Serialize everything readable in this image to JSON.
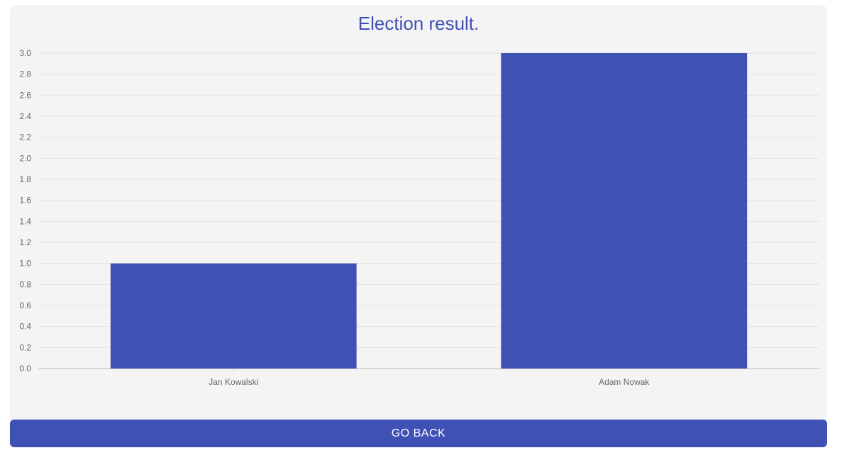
{
  "chart_data": {
    "type": "bar",
    "title": "Election result.",
    "categories": [
      "Jan Kowalski",
      "Adam Nowak"
    ],
    "values": [
      1,
      3
    ],
    "ylim": [
      0,
      3
    ],
    "yticks": [
      "0.0",
      "0.2",
      "0.4",
      "0.6",
      "0.8",
      "1.0",
      "1.2",
      "1.4",
      "1.6",
      "1.8",
      "2.0",
      "2.2",
      "2.4",
      "2.6",
      "2.8",
      "3.0"
    ],
    "grid": true,
    "bar_color": "#3f51b5",
    "xlabel": "",
    "ylabel": ""
  },
  "actions": {
    "go_back_label": "GO BACK"
  },
  "colors": {
    "accent": "#3f51b5",
    "card_background": "#f4f4f4"
  }
}
